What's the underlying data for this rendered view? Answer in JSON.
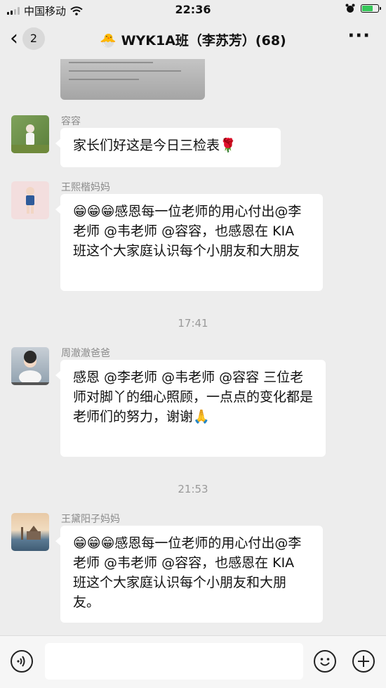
{
  "status": {
    "carrier": "中国移动",
    "time": "22:36"
  },
  "nav": {
    "back_badge": "2",
    "title": "WYK1A班（李苏芳）(68)"
  },
  "messages": [
    {
      "sender": "容容",
      "text": "家长们好这是今日三检表🌹"
    },
    {
      "sender": "王熙楷妈妈",
      "text": "😁😁😁感恩每一位老师的用心付出@李老师 @韦老师 @容容，也感恩在 KIA 班这个大家庭认识每个小朋友和大朋友"
    },
    {
      "timestamp": "17:41"
    },
    {
      "sender": "周澈澈爸爸",
      "text": "感恩 @李老师 @韦老师 @容容 三位老师对脚丫的细心照顾，一点点的变化都是老师们的努力，谢谢🙏"
    },
    {
      "timestamp": "21:53"
    },
    {
      "sender": "王黛阳子妈妈",
      "text": "😁😁😁感恩每一位老师的用心付出@李老师 @韦老师 @容容，也感恩在 KIA 班这个大家庭认识每个小朋友和大朋友。"
    }
  ],
  "icons": {
    "signal": "signal-icon",
    "wifi": "wifi-icon",
    "alarm": "alarm-icon",
    "battery": "battery-icon",
    "back": "chevron-left-icon",
    "more": "more-icon",
    "voice": "voice-icon",
    "emoji": "emoji-icon",
    "plus": "plus-icon"
  },
  "colors": {
    "background": "#ededed",
    "bubble": "#ffffff",
    "battery_fill": "#35c759"
  }
}
